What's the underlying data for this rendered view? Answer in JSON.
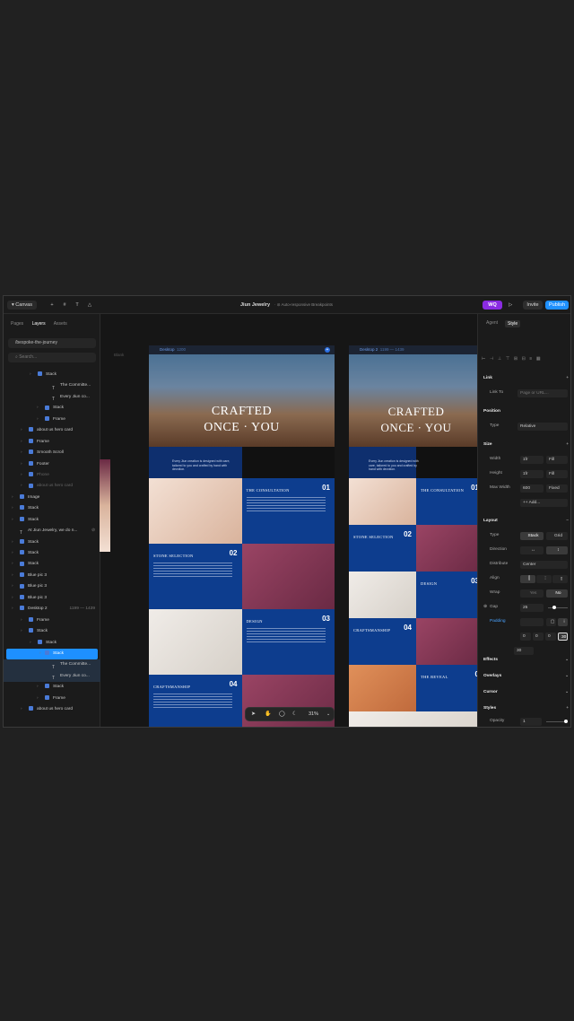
{
  "topbar": {
    "canvas_label": "Canvas",
    "title": "Jiun Jewelry",
    "subtitle": "· ⊘ Auto-responsive Breakpoints",
    "wq": "WQ",
    "invite": "Invite",
    "publish": "Publish"
  },
  "left": {
    "tabs": [
      "Pages",
      "Layers",
      "Assets"
    ],
    "page": "/bespoke-the-journey",
    "search_placeholder": "Search...",
    "layers": [
      {
        "label": "Stack",
        "indent": 38,
        "icon": "stack"
      },
      {
        "label": "The Committe...",
        "indent": 54,
        "icon": "text"
      },
      {
        "label": "Every Jiun co...",
        "indent": 54,
        "icon": "text"
      },
      {
        "label": "Stack",
        "indent": 46,
        "icon": "stack"
      },
      {
        "label": "Frame",
        "indent": 46,
        "icon": "stack"
      },
      {
        "label": "about us hero card",
        "indent": 28,
        "icon": "stack"
      },
      {
        "label": "Frame",
        "indent": 28,
        "icon": "stack"
      },
      {
        "label": "Smooth Scroll",
        "indent": 28,
        "icon": "stack"
      },
      {
        "label": "Footer",
        "indent": 28,
        "icon": "stack"
      },
      {
        "label": "Phone",
        "indent": 28,
        "icon": "stack",
        "dim": true
      },
      {
        "label": "about us hero card",
        "indent": 28,
        "icon": "stack",
        "dim": true
      },
      {
        "label": "Image",
        "indent": 18,
        "icon": "stack"
      },
      {
        "label": "Stack",
        "indent": 18,
        "icon": "stack"
      },
      {
        "label": "Stack",
        "indent": 18,
        "icon": "stack"
      },
      {
        "label": "At Jiun Jewelry, we do n...",
        "indent": 18,
        "icon": "text",
        "extra": "⊘"
      },
      {
        "label": "Stack",
        "indent": 18,
        "icon": "stack"
      },
      {
        "label": "Stack",
        "indent": 18,
        "icon": "stack"
      },
      {
        "label": "Stack",
        "indent": 18,
        "icon": "stack"
      },
      {
        "label": "Blue pic 3",
        "indent": 18,
        "icon": "stack"
      },
      {
        "label": "Blue pic 3",
        "indent": 18,
        "icon": "stack"
      },
      {
        "label": "Blue pic 3",
        "indent": 18,
        "icon": "stack"
      },
      {
        "label": "Desktop 2",
        "indent": 18,
        "icon": "stack",
        "extra": "1199 — 1439"
      },
      {
        "label": "Frame",
        "indent": 28,
        "icon": "stack"
      },
      {
        "label": "Stack",
        "indent": 28,
        "icon": "stack"
      },
      {
        "label": "Stack",
        "indent": 38,
        "icon": "stack"
      },
      {
        "label": "Stack",
        "indent": 46,
        "icon": "stack",
        "selected": true
      },
      {
        "label": "The Committe...",
        "indent": 54,
        "icon": "text",
        "sub": true
      },
      {
        "label": "Every Jiun co...",
        "indent": 54,
        "icon": "text",
        "sub": true
      },
      {
        "label": "Stack",
        "indent": 46,
        "icon": "stack"
      },
      {
        "label": "Frame",
        "indent": 46,
        "icon": "stack"
      },
      {
        "label": "about us hero card",
        "indent": 28,
        "icon": "stack"
      }
    ]
  },
  "canvas": {
    "side_label": "Blank",
    "frame1": {
      "name": "Desktop",
      "size": "1200"
    },
    "frame2": {
      "name": "Desktop 2",
      "size": "1199 — 1439"
    },
    "hero_line1": "CRAFTED",
    "hero_line2": "ONCE · YOU",
    "intro": "Every Jiun creation is designed with care, tailored to you and crafted by hand with devotion.",
    "steps": [
      {
        "title": "THE CONSULTATION",
        "num": "01"
      },
      {
        "title": "STONE SELECTION",
        "num": "02"
      },
      {
        "title": "DESIGN",
        "num": "03"
      },
      {
        "title": "CRAFTSMANSHIP",
        "num": "04"
      },
      {
        "title": "THE REVEAL",
        "num": "0"
      }
    ],
    "zoom": "31%"
  },
  "right": {
    "tabs": [
      "Agent",
      "Style"
    ],
    "link": {
      "section": "Link",
      "label": "Link To",
      "placeholder": "Page or URL..."
    },
    "position": {
      "section": "Position",
      "type_label": "Type",
      "type": "Relative"
    },
    "size": {
      "section": "Size",
      "width_label": "Width",
      "width": "1fr",
      "width_mode": "Fill",
      "height_label": "Height",
      "height": "1fr",
      "height_mode": "Fill",
      "maxw_label": "Max Width",
      "maxw": "600",
      "maxw_mode": "Fixed",
      "add": "Add..."
    },
    "layout": {
      "section": "Layout",
      "type_label": "Type",
      "stack": "Stack",
      "grid": "Grid",
      "direction_label": "Direction",
      "distribute_label": "Distribute",
      "distribute": "Center",
      "align_label": "Align",
      "wrap_label": "Wrap",
      "wrap_yes": "Yes",
      "wrap_no": "No",
      "gap_label": "Gap",
      "gap": "25",
      "padding_label": "Padding",
      "pad_vals": [
        "0",
        "0",
        "0",
        "30"
      ],
      "pad_extra": "30"
    },
    "effects": "Effects",
    "overlays": "Overlays",
    "cursor": "Cursor",
    "styles": "Styles",
    "opacity_label": "Opacity",
    "opacity": "1",
    "opacity_level": 1
  }
}
